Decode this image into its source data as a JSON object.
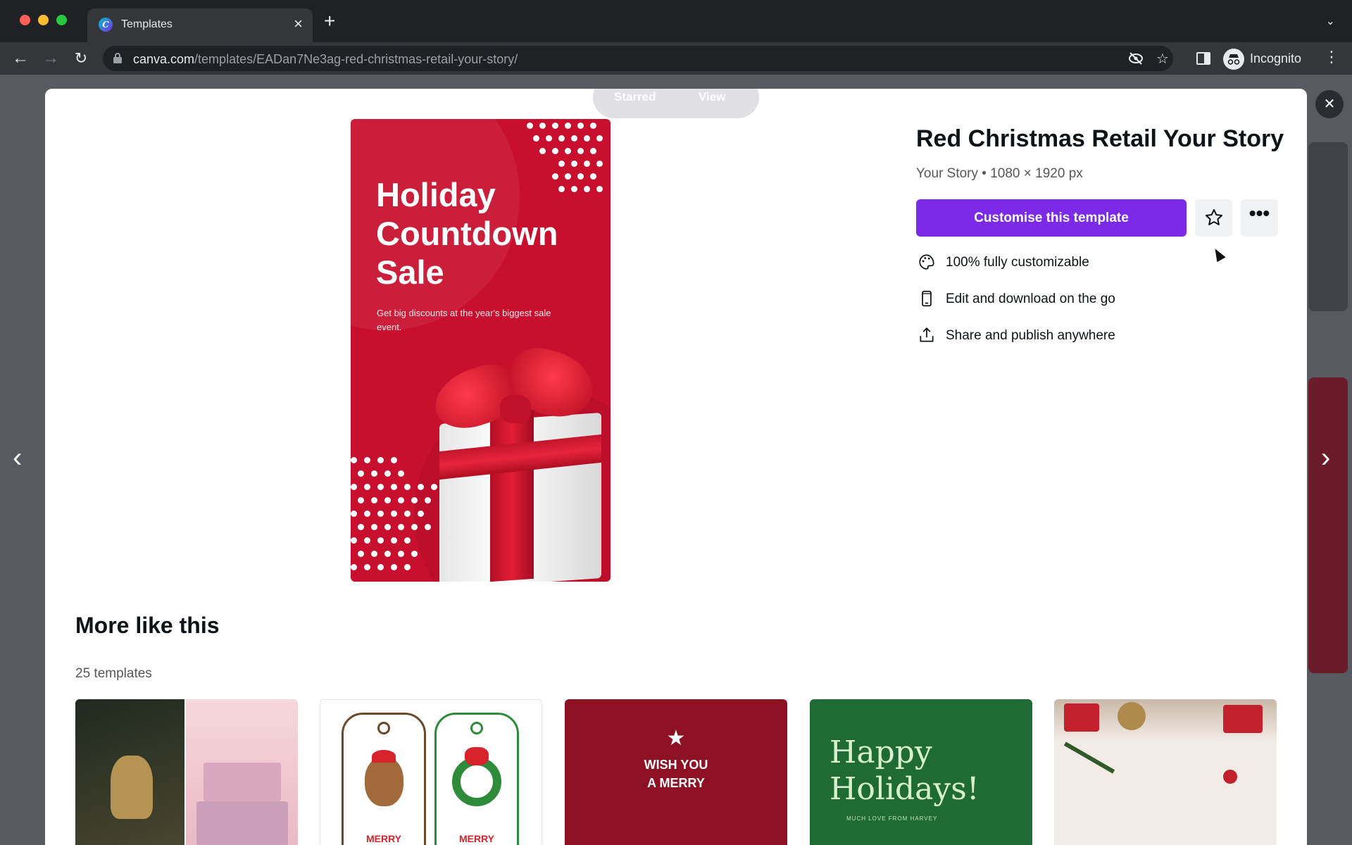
{
  "browser": {
    "tab_title": "Templates",
    "url_host": "canva.com",
    "url_path": "/templates/EADan7Ne3ag-red-christmas-retail-your-story/",
    "profile_label": "Incognito",
    "icons": [
      "back-icon",
      "forward-icon",
      "reload-icon",
      "lock-icon",
      "eye-off-icon",
      "bookmark-star-icon",
      "side-panel-icon",
      "incognito-icon",
      "kebab-icon"
    ]
  },
  "overlay": {
    "starred_label": "Starred",
    "view_label": "View"
  },
  "template": {
    "title": "Red Christmas Retail Your Story",
    "meta": "Your Story • 1080 × 1920 px",
    "customise_label": "Customise this template",
    "more_label": "•••",
    "features": [
      {
        "icon": "palette-icon",
        "text": "100% fully customizable"
      },
      {
        "icon": "phone-icon",
        "text": "Edit and download on the go"
      },
      {
        "icon": "share-icon",
        "text": "Share and publish anywhere"
      }
    ],
    "preview": {
      "title": "Holiday Countdown Sale",
      "subtitle": "Get big discounts at the year's biggest sale event."
    }
  },
  "more_like_this": {
    "heading": "More like this",
    "count": "25 templates",
    "thumbs": [
      {
        "caption": "",
        "bg": "#3a3b2e"
      },
      {
        "caption": "MERRY CHRISTMAS",
        "bg": "#ffffff"
      },
      {
        "caption": "WISH YOU A MERRY",
        "bg": "#8e1023"
      },
      {
        "caption": "Happy Holidays!",
        "sub": "MUCH LOVE FROM HARVEY",
        "bg": "#1f6b35"
      },
      {
        "caption": "",
        "bg": "#f3ece6"
      }
    ]
  },
  "colors": {
    "accent": "#7d2ae8",
    "preview_red": "#c8102e"
  }
}
